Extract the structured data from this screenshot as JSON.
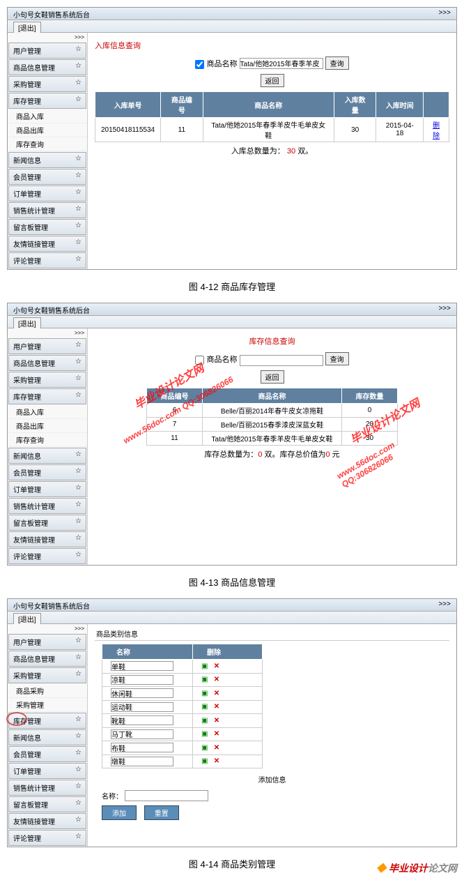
{
  "common": {
    "header_title": "小句号女鞋销售系统后台",
    "logout_btn": "[退出]",
    "triple_arrow": ">>>",
    "expand": "☆",
    "menu": {
      "user_mgmt": "用户管理",
      "product_info": "商品信息管理",
      "purchase": "采购管理",
      "inventory": "库存管理",
      "inv_in": "商品入库",
      "inv_out": "商品出库",
      "inv_query": "库存查询",
      "news": "新闻信息",
      "member": "会员管理",
      "order": "订单管理",
      "sales_stat": "销售统计管理",
      "message": "留言板管理",
      "friendlink": "友情链接管理",
      "comment": "评论管理",
      "purchase_plan": "商品采购",
      "purchase_mgmt": "采购管理"
    }
  },
  "fig12": {
    "caption": "图 4-12 商品库存管理",
    "title": "入库信息查询",
    "checkbox_label": "商品名称",
    "search_text": "Tata/他她2015年春季羊皮",
    "btn_search": "查询",
    "btn_back": "返回",
    "table_headers": [
      "入库单号",
      "商品编号",
      "商品名称",
      "入库数量",
      "入库时间",
      ""
    ],
    "row": [
      "20150418115534",
      "11",
      "Tata/他她2015年春季羊皮牛毛单皮女鞋",
      "30",
      "2015-04-18",
      "删除"
    ],
    "summary_prefix": "入库总数量为：",
    "summary_value": "30",
    "summary_suffix": "双。"
  },
  "fig13": {
    "caption": "图 4-13  商品信息管理",
    "title": "库存信息查询",
    "checkbox_label": "商品名称",
    "btn_search": "查询",
    "btn_back": "返回",
    "table_headers": [
      "商品编号",
      "商品名称",
      "库存数量"
    ],
    "rows": [
      [
        "6",
        "Belle/百丽2014年春牛皮女凉拖鞋",
        "0"
      ],
      [
        "7",
        "Belle/百丽2015春季漆皮深蓝女鞋",
        "20"
      ],
      [
        "11",
        "Tata/他她2015年春季羊皮牛毛单皮女鞋",
        "30"
      ]
    ],
    "summary_prefix": "库存总数量为：",
    "summary_val1": "0",
    "summary_mid": " 双。库存总价值为",
    "summary_val2": "0",
    "summary_suffix": " 元",
    "watermark1": "毕业设计论文网",
    "watermark2": "www.56doc.com   QQ:306826066",
    "watermark3": "毕业设计论文网",
    "watermark4": "www.56doc.com   QQ:306826066"
  },
  "fig14": {
    "caption": "图 4-14 商品类别管理",
    "section_label": "商品类别信息",
    "col_name": "名称",
    "col_action": "删除",
    "categories": [
      "单鞋",
      "凉鞋",
      "休闲鞋",
      "运动鞋",
      "靴鞋",
      "马丁靴",
      "布鞋",
      "墩鞋"
    ],
    "add_section": "添加信息",
    "name_label": "名称：",
    "btn_add": "添加",
    "btn_reset": "重置"
  },
  "footer": {
    "text1": "毕业设计",
    "text2": "论文网"
  }
}
